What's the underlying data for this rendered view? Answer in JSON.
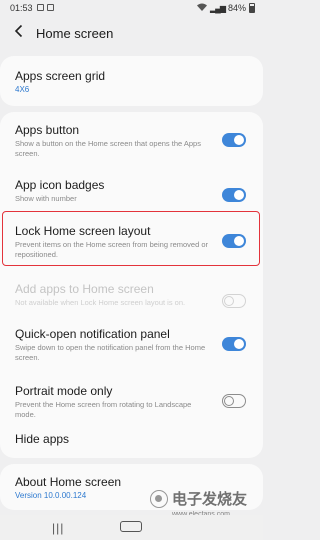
{
  "status_bar": {
    "time": "01:53",
    "battery": "84%",
    "icons": [
      "notification-icon",
      "image-icon",
      "wifi-icon",
      "signal-icon",
      "battery-icon"
    ]
  },
  "header": {
    "title": "Home screen",
    "back_icon": "chevron-left-icon"
  },
  "grid": {
    "title": "Apps screen grid",
    "value": "4X6"
  },
  "settings": [
    {
      "title": "Apps button",
      "subtitle": "Show a button on the Home screen that opens the Apps screen.",
      "toggle": "on",
      "enabled": true
    },
    {
      "title": "App icon badges",
      "subtitle": "Show with number",
      "toggle": "on",
      "enabled": true
    },
    {
      "title": "Lock Home screen layout",
      "subtitle": "Prevent items on the Home screen from being removed or repositioned.",
      "toggle": "on",
      "enabled": true,
      "highlighted": true
    },
    {
      "title": "Add apps to Home screen",
      "subtitle": "Not available when Lock Home screen layout is on.",
      "toggle": "off",
      "enabled": false
    },
    {
      "title": "Quick-open notification panel",
      "subtitle": "Swipe down to open the notification panel from the Home screen.",
      "toggle": "on",
      "enabled": true
    },
    {
      "title": "Portrait mode only",
      "subtitle": "Prevent the Home screen from rotating to Landscape mode.",
      "toggle": "off",
      "enabled": true
    },
    {
      "title": "Hide apps"
    }
  ],
  "about": {
    "title": "About Home screen",
    "version": "Version 10.0.00.124"
  },
  "watermark": {
    "text": "电子发烧友",
    "url": "www.elecfans.com"
  },
  "colors": {
    "accent": "#3e86d9",
    "highlight": "#e3333b",
    "background": "#efeff0",
    "card": "#fafafa"
  }
}
